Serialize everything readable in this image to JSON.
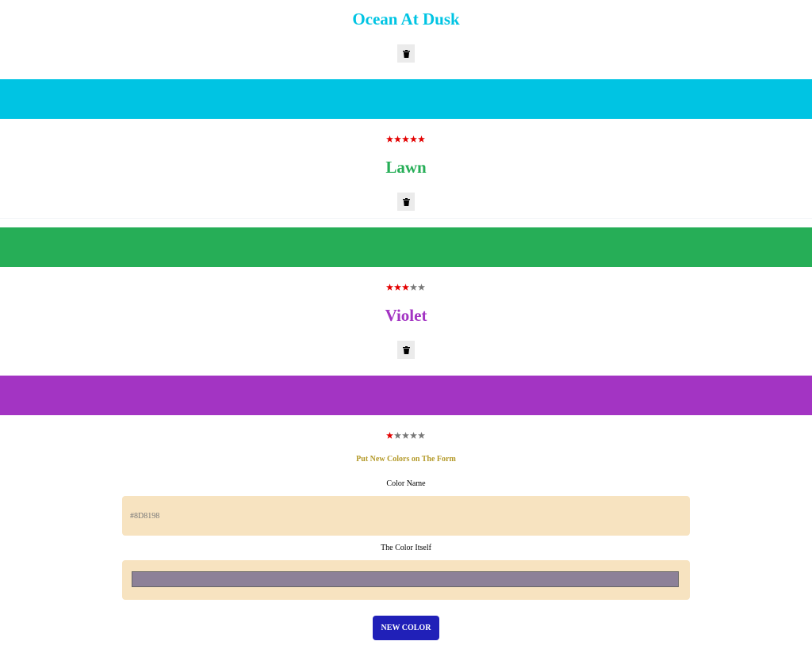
{
  "colors": [
    {
      "name": "Ocean At Dusk",
      "hex": "#00c4e3",
      "rating": 5
    },
    {
      "name": "Lawn",
      "hex": "#26ae57",
      "rating": 3
    },
    {
      "name": "Violet",
      "hex": "#a334c3",
      "rating": 1
    }
  ],
  "rating_max": 5,
  "star_colors": {
    "filled": "#e30000",
    "empty": "#777777"
  },
  "icons": {
    "delete": "trash-icon",
    "rating": "star-icon"
  },
  "form": {
    "heading": "Put New Colors on The Form",
    "name_label": "Color Name",
    "name_placeholder": "#8D8198",
    "color_label": "The Color Itself",
    "color_value": "#8D8198",
    "submit_label": "NEW COLOR"
  }
}
